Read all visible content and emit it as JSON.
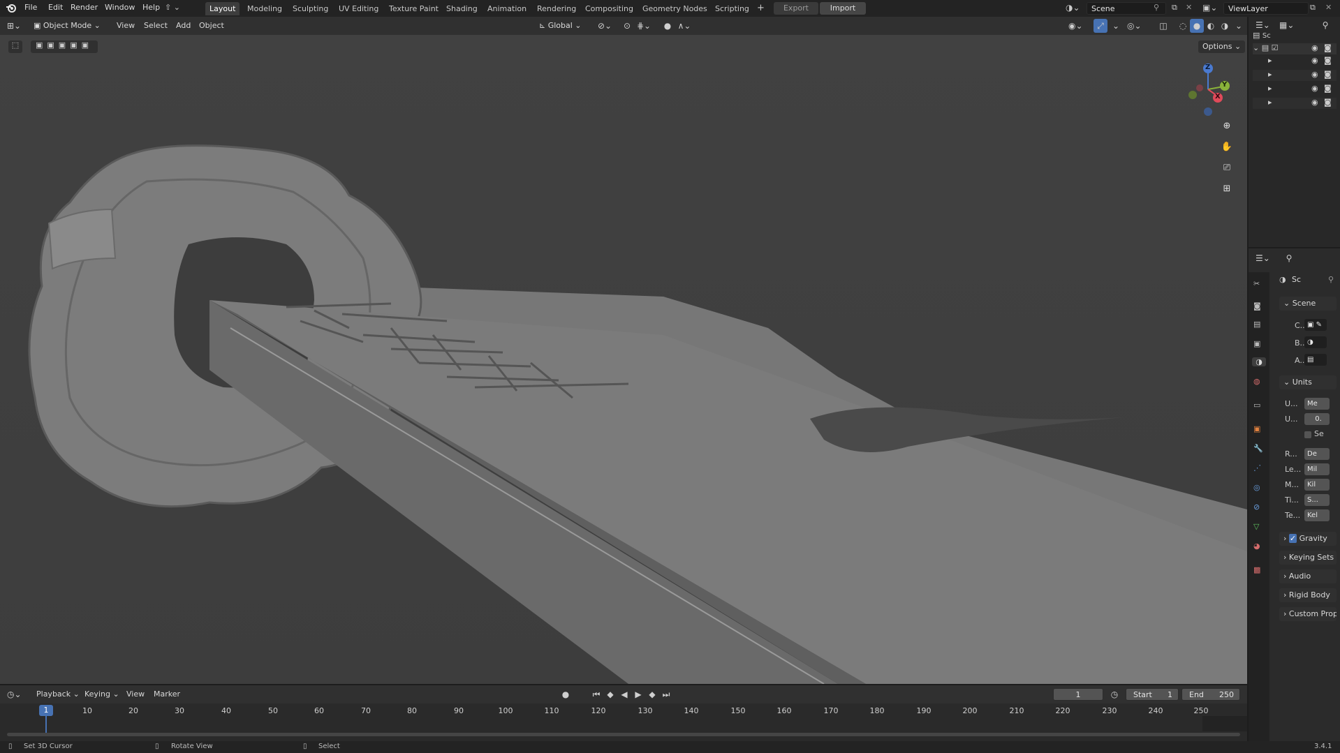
{
  "menu": [
    "File",
    "Edit",
    "Render",
    "Window",
    "Help"
  ],
  "workspaces": [
    "Layout",
    "Modeling",
    "Sculpting",
    "UV Editing",
    "Texture Paint",
    "Shading",
    "Animation",
    "Rendering",
    "Compositing",
    "Geometry Nodes",
    "Scripting"
  ],
  "active_workspace": "Layout",
  "export_label": "Export",
  "import_label": "Import",
  "scene_name": "Scene",
  "view_layer": "ViewLayer",
  "viewport_header": {
    "mode": "Object Mode",
    "menus": [
      "View",
      "Select",
      "Add",
      "Object"
    ],
    "orientation": "Global",
    "options_label": "Options"
  },
  "gizmo": {
    "z": "Z",
    "y": "Y",
    "x": "X"
  },
  "outliner": {
    "root_label": "Sc"
  },
  "properties": {
    "header_label": "Sc",
    "scene_panel": "Scene",
    "scene_rows": [
      {
        "label": "C..."
      },
      {
        "label": "B..."
      },
      {
        "label": "A..."
      }
    ],
    "units_panel": "Units",
    "units_rows": [
      {
        "label": "U...",
        "value": "Me"
      },
      {
        "label": "U...",
        "value": "0."
      },
      {
        "label": "",
        "value": "Se"
      },
      {
        "label": "R...",
        "value": "De"
      },
      {
        "label": "Le...",
        "value": "Mil"
      },
      {
        "label": "M...",
        "value": "Kil"
      },
      {
        "label": "Ti...",
        "value": "S..."
      },
      {
        "label": "Te...",
        "value": "Kel"
      }
    ],
    "collapsed_panels": [
      "Gravity",
      "Keying Sets",
      "Audio",
      "Rigid Body",
      "Custom Prop"
    ]
  },
  "timeline": {
    "menus": [
      "Playback",
      "Keying",
      "View",
      "Marker"
    ],
    "current_frame": "1",
    "start_label": "Start",
    "start_value": "1",
    "end_label": "End",
    "end_value": "250",
    "ticks": [
      "10",
      "20",
      "30",
      "40",
      "50",
      "60",
      "70",
      "80",
      "90",
      "100",
      "110",
      "120",
      "130",
      "140",
      "150",
      "160",
      "170",
      "180",
      "190",
      "200",
      "210",
      "220",
      "230",
      "240",
      "250"
    ],
    "playhead_label": "1"
  },
  "statusbar": {
    "left": "Set 3D Cursor",
    "middle": "Rotate View",
    "right": "Select",
    "version": "3.4.1"
  }
}
